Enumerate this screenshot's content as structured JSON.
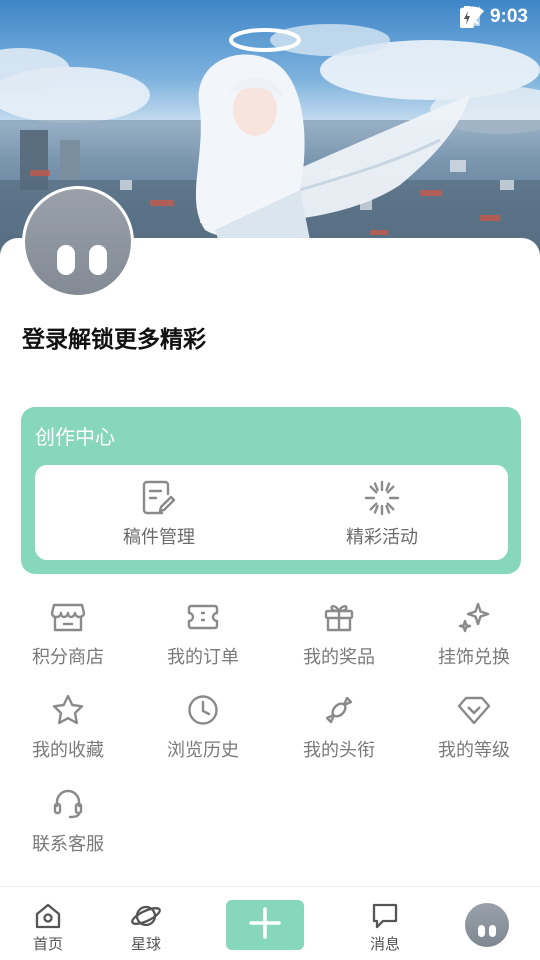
{
  "status_bar": {
    "time": "9:03"
  },
  "profile": {
    "login_prompt": "登录解锁更多精彩"
  },
  "creation_center": {
    "title": "创作中心",
    "items": [
      {
        "label": "稿件管理",
        "icon": "edit-document-icon"
      },
      {
        "label": "精彩活动",
        "icon": "sparkle-burst-icon"
      }
    ]
  },
  "menu": [
    {
      "label": "积分商店",
      "icon": "store-icon"
    },
    {
      "label": "我的订单",
      "icon": "ticket-icon"
    },
    {
      "label": "我的奖品",
      "icon": "gift-icon"
    },
    {
      "label": "挂饰兑换",
      "icon": "sparkles-icon"
    },
    {
      "label": "我的收藏",
      "icon": "star-icon"
    },
    {
      "label": "浏览历史",
      "icon": "clock-icon"
    },
    {
      "label": "我的头衔",
      "icon": "candy-icon"
    },
    {
      "label": "我的等级",
      "icon": "diamond-icon"
    },
    {
      "label": "联系客服",
      "icon": "headset-icon"
    }
  ],
  "bottom_nav": [
    {
      "label": "首页",
      "icon": "home-icon"
    },
    {
      "label": "星球",
      "icon": "planet-icon"
    },
    {
      "label": "",
      "icon": "plus-icon"
    },
    {
      "label": "消息",
      "icon": "message-icon"
    },
    {
      "label": "",
      "icon": "avatar"
    }
  ],
  "colors": {
    "accent": "#86d7bc",
    "text_gray": "#7a7a7a",
    "icon_gray": "#8a8a8a"
  }
}
